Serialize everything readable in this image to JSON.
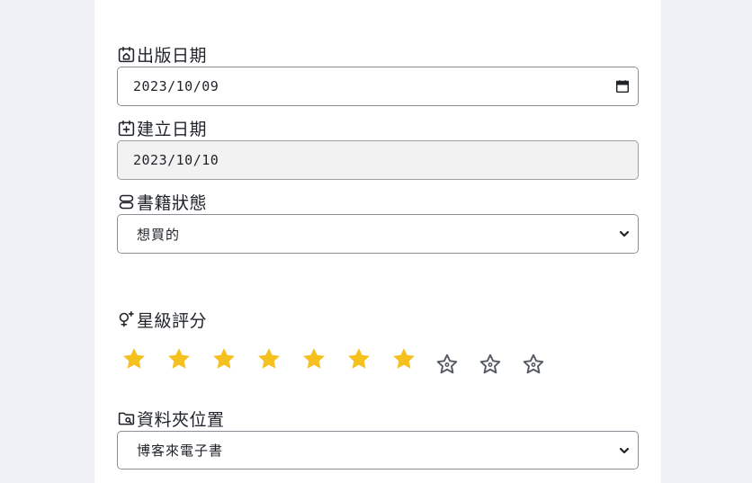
{
  "publish_date": {
    "label": "出版日期",
    "icon": "calendar-home-icon",
    "value": "2023/10/09"
  },
  "created_date": {
    "label": "建立日期",
    "icon": "calendar-plus-icon",
    "value": "2023/10/10"
  },
  "book_status": {
    "label": "書籍狀態",
    "icon": "status-icon",
    "selected": "想買的"
  },
  "rating": {
    "label": "星級評分",
    "icon": "sparkle-bulb-icon",
    "value": 7,
    "max": 10,
    "filled_color": "#f6c01e",
    "empty_color": "#555b63"
  },
  "folder_location": {
    "label": "資料夾位置",
    "icon": "folder-search-icon",
    "selected": "博客來電子書"
  }
}
